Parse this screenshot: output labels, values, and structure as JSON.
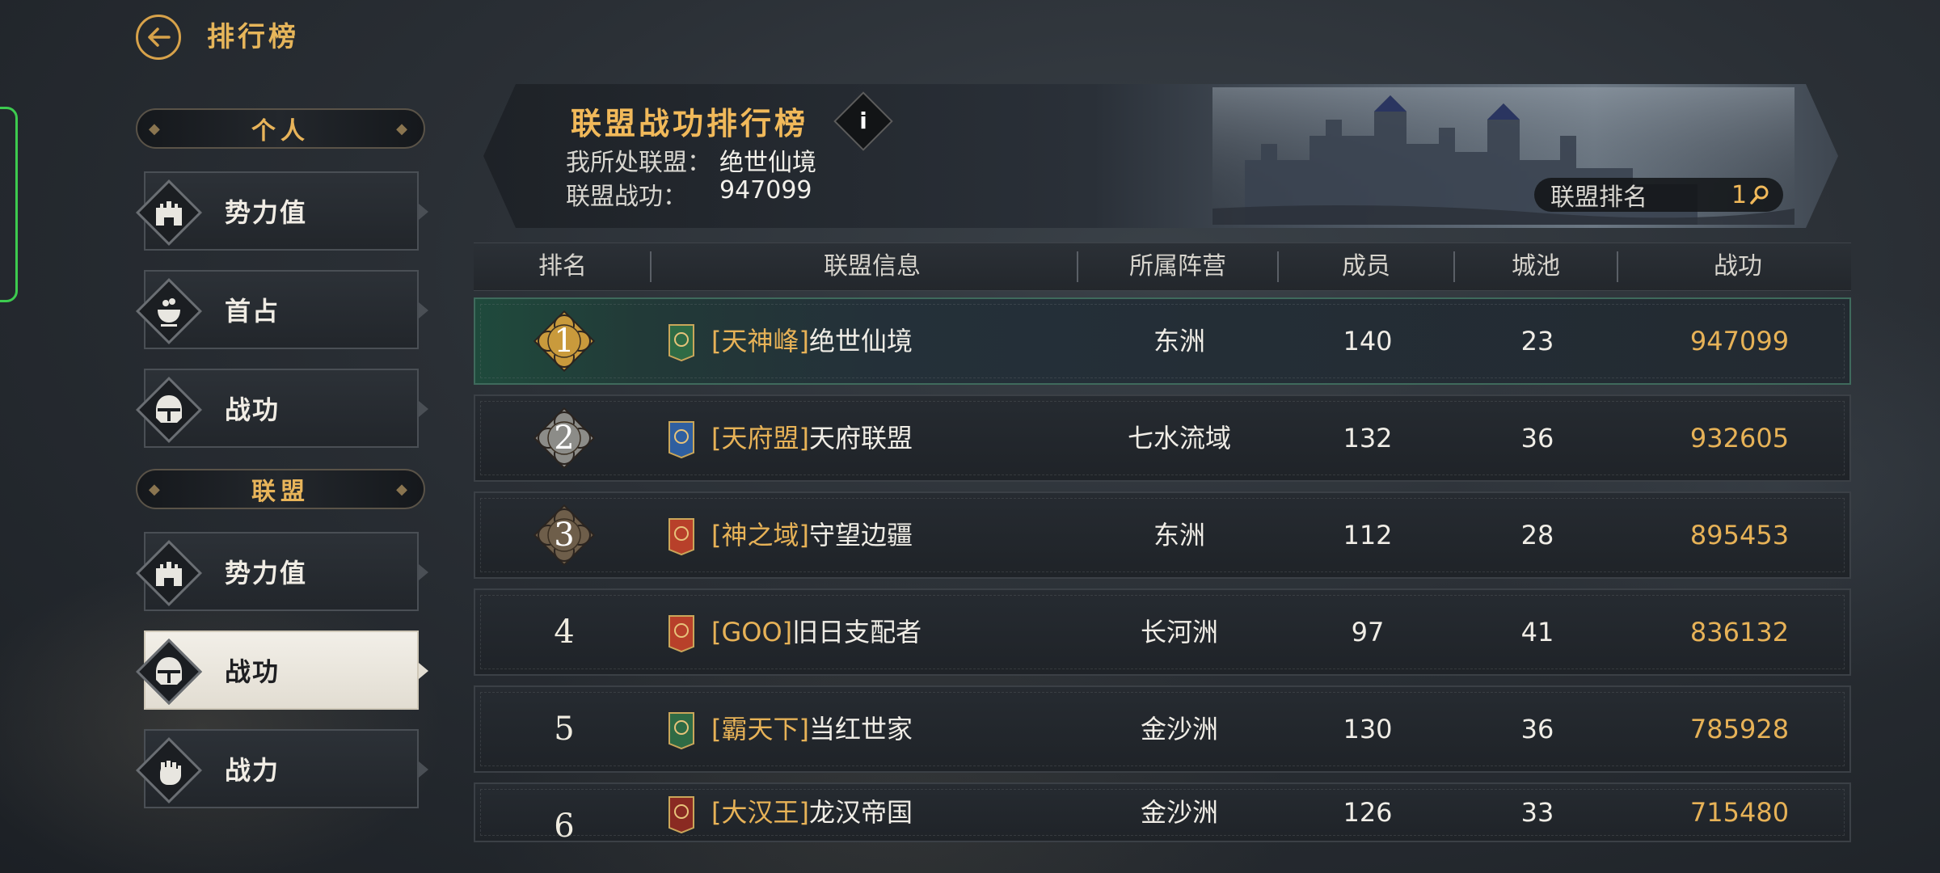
{
  "header": {
    "title": "排行榜"
  },
  "sidebar": {
    "sections": [
      {
        "title": "个人",
        "items": [
          {
            "label": "势力值",
            "icon": "castle-icon"
          },
          {
            "label": "首占",
            "icon": "cauldron-icon"
          },
          {
            "label": "战功",
            "icon": "helmet-icon"
          }
        ]
      },
      {
        "title": "联盟",
        "items": [
          {
            "label": "势力值",
            "icon": "castle-icon"
          },
          {
            "label": "战功",
            "icon": "helmet-icon",
            "active": true
          },
          {
            "label": "战力",
            "icon": "fist-icon"
          }
        ]
      }
    ]
  },
  "banner": {
    "title": "联盟战功排行榜",
    "info_label": "i",
    "my_alliance_label": "我所处联盟：",
    "my_alliance_value": "绝世仙境",
    "alliance_merit_label": "联盟战功：",
    "alliance_merit_value": "947099",
    "alliance_rank_label": "联盟排名",
    "alliance_rank_value": "1"
  },
  "table": {
    "columns": [
      "排名",
      "联盟信息",
      "所属阵营",
      "成员",
      "城池",
      "战功"
    ],
    "rows": [
      {
        "rank": "1",
        "tag": "[天神峰]",
        "name": "绝世仙境",
        "camp": "东洲",
        "members": "140",
        "cities": "23",
        "merit": "947099",
        "flag_color": "#2f6b45"
      },
      {
        "rank": "2",
        "tag": "[天府盟]",
        "name": "天府联盟",
        "camp": "七水流域",
        "members": "132",
        "cities": "36",
        "merit": "932605",
        "flag_color": "#2f5fa0"
      },
      {
        "rank": "3",
        "tag": "[神之域]",
        "name": "守望边疆",
        "camp": "东洲",
        "members": "112",
        "cities": "28",
        "merit": "895453",
        "flag_color": "#b8402a"
      },
      {
        "rank": "4",
        "tag": "[GOO]",
        "name": "旧日支配者",
        "camp": "长河洲",
        "members": "97",
        "cities": "41",
        "merit": "836132",
        "flag_color": "#b8402a"
      },
      {
        "rank": "5",
        "tag": "[霸天下]",
        "name": "当红世家",
        "camp": "金沙洲",
        "members": "130",
        "cities": "36",
        "merit": "785928",
        "flag_color": "#2f6b45"
      },
      {
        "rank": "6",
        "tag": "[大汉王]",
        "name": "龙汉帝国",
        "camp": "金沙洲",
        "members": "126",
        "cities": "33",
        "merit": "715480",
        "flag_color": "#8a2a22"
      }
    ]
  },
  "colors": {
    "accent": "#e7b257",
    "gold_medal": "#c99a3c",
    "silver_medal": "#8c8c88",
    "bronze_medal": "#6e5e4a"
  }
}
